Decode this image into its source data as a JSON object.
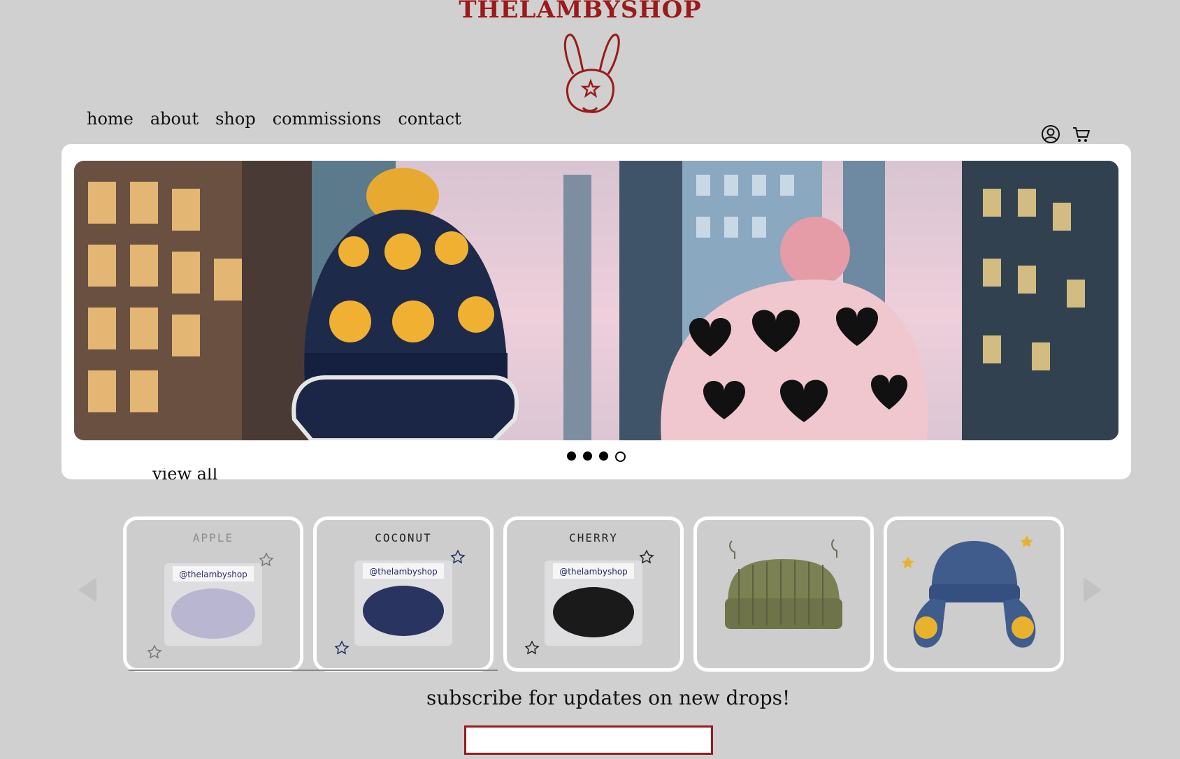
{
  "brand": {
    "name": "THELAMBYSHOP",
    "accent_color": "#9b1a1a",
    "logo_icon": "bunny-icon"
  },
  "nav": {
    "items": [
      "home",
      "about",
      "shop",
      "commissions",
      "contact"
    ]
  },
  "utility": {
    "account_icon": "user-circle-icon",
    "cart_icon": "shopping-cart-icon"
  },
  "hero": {
    "image": "two knitted pom-pom hats in a city",
    "slides_total": 4,
    "active_slide": 4
  },
  "shop_section": {
    "view_all_label": "view all"
  },
  "products": [
    {
      "name": "APPLE",
      "tag": "@thelambyshop",
      "color": "#b9b6d1"
    },
    {
      "name": "COCONUT",
      "tag": "@thelambyshop",
      "color": "#2a3460"
    },
    {
      "name": "CHERRY",
      "tag": "@thelambyshop",
      "color": "#1a1a1a"
    },
    {
      "name": "",
      "tag": "",
      "color": "#7c8154"
    },
    {
      "name": "",
      "tag": "",
      "color": "#3f5c8c"
    }
  ],
  "subscribe": {
    "label": "subscribe for updates on new drops!",
    "input_value": "",
    "input_placeholder": ""
  }
}
